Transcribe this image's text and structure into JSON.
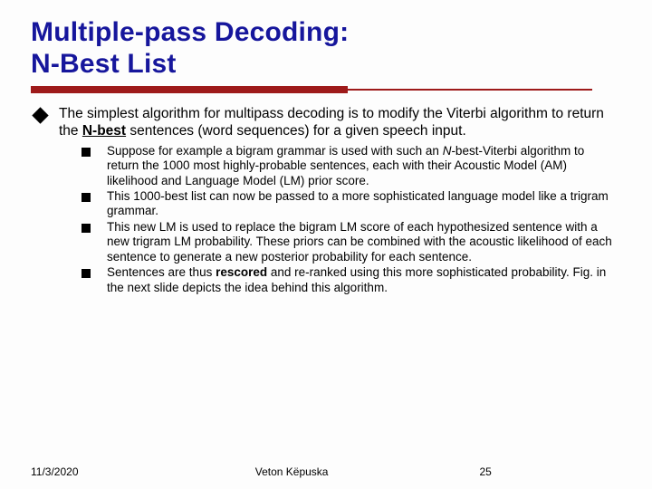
{
  "title_line1": "Multiple-pass Decoding:",
  "title_line2": "N-Best List",
  "l1_a": "The simplest algorithm for multipass decoding is to modify the Viterbi algorithm to return the ",
  "l1_bold": "N-best",
  "l1_b": " sentences (word sequences) for a given speech input.",
  "sub": [
    {
      "a": "Suppose for example a bigram grammar is used with such an ",
      "ital": "N",
      "b": "-best-Viterbi algorithm to return the 1000 most highly-probable sentences, each with their Acoustic Model (AM) likelihood and Language Model (LM) prior score."
    },
    {
      "a": "This 1000-best list can now be passed to a more sophisticated language model like a trigram grammar.",
      "ital": "",
      "b": ""
    },
    {
      "a": "This new LM is used to replace the bigram LM score of each hypothesized sentence with a new trigram LM probability. These priors can be combined with the acoustic likelihood of each sentence to generate a new posterior probability for each sentence.",
      "ital": "",
      "b": ""
    },
    {
      "a": "Sentences are thus ",
      "bold": "rescored",
      "b": " and re-ranked using this more sophisticated probability. Fig. in the next slide depicts the idea behind this algorithm."
    }
  ],
  "footer": {
    "date": "11/3/2020",
    "author": "Veton Këpuska",
    "page": "25"
  }
}
